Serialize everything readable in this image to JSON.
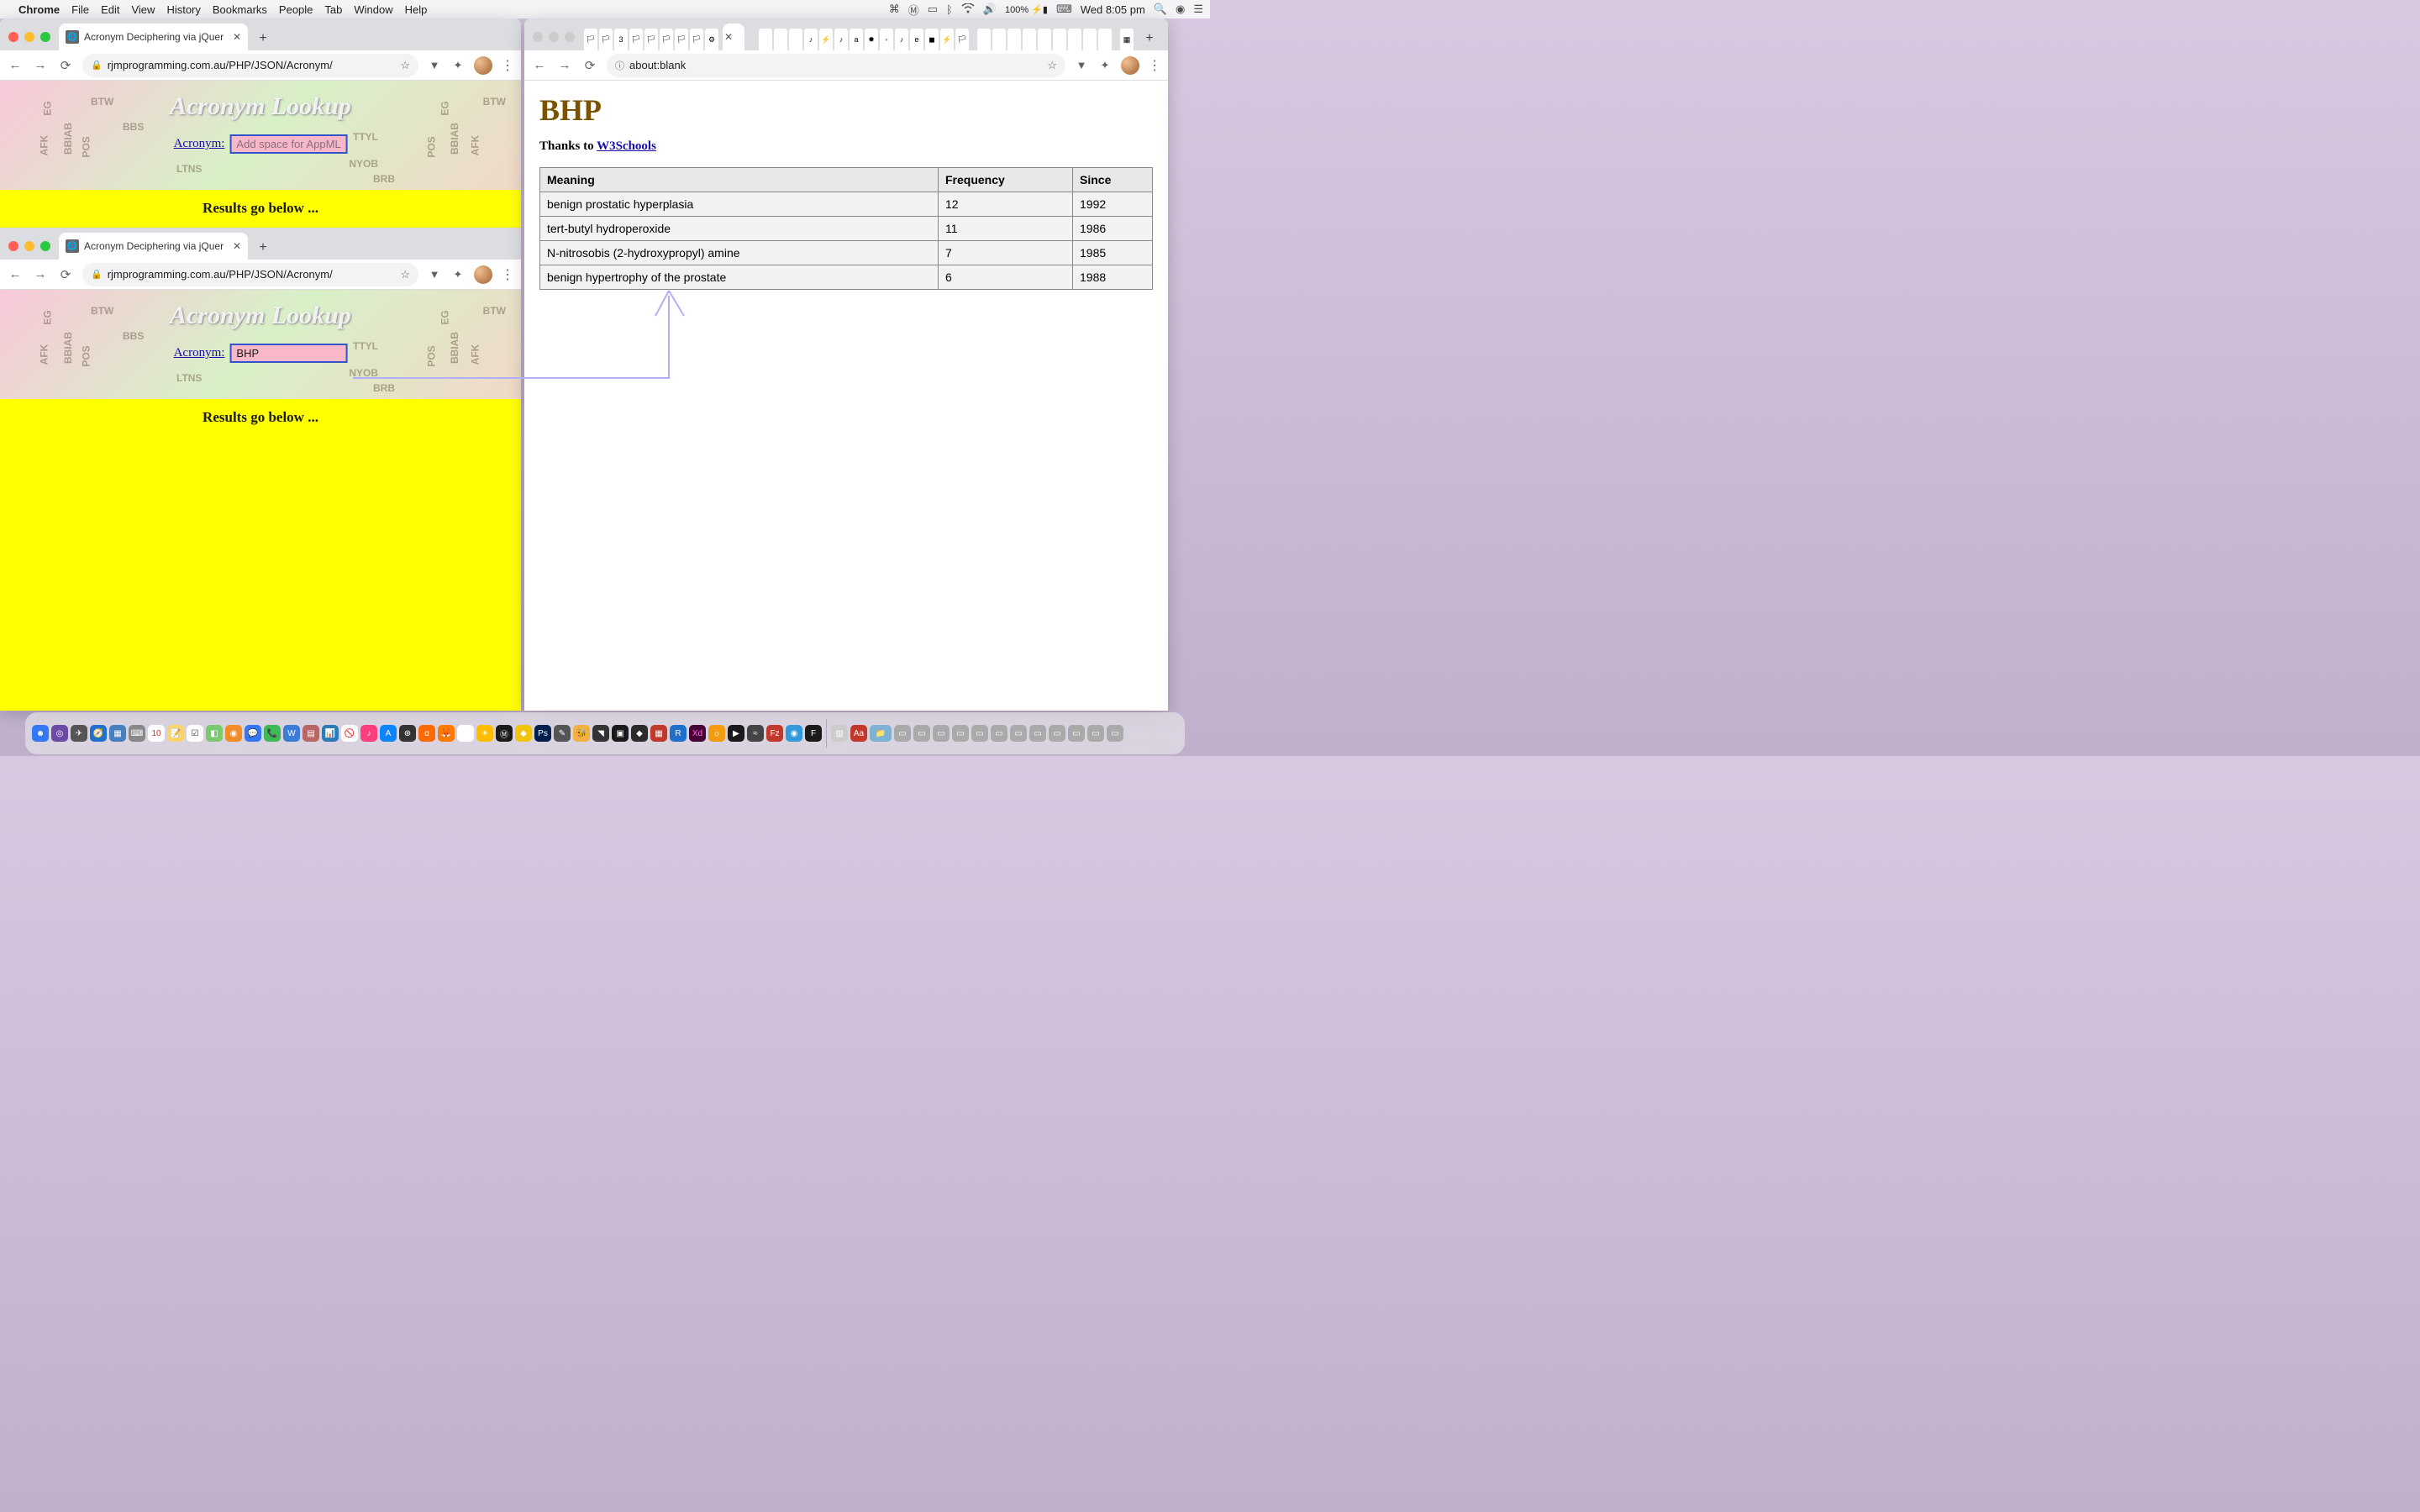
{
  "menubar": {
    "app": "Chrome",
    "items": [
      "File",
      "Edit",
      "View",
      "History",
      "Bookmarks",
      "People",
      "Tab",
      "Window",
      "Help"
    ],
    "battery": "100%",
    "clock": "Wed 8:05 pm"
  },
  "windowLeft": {
    "tab": {
      "title": "Acronym Deciphering via jQuer"
    },
    "url": "rjmprogramming.com.au/PHP/JSON/Acronym/",
    "instance1": {
      "title": "Acronym Lookup",
      "label": "Acronym:",
      "placeholder": "Add space for AppML",
      "value": "",
      "results": "Results go below ...",
      "bg": {
        "btw": "BTW",
        "bbs": "BBS",
        "ltns": "LTNS",
        "ttyl": "TTYL",
        "nyob": "NYOB",
        "brb": "BRB",
        "afk": "AFK",
        "bbiab": "BBIAB",
        "eg": "EG",
        "pos": "POS"
      }
    },
    "instance2": {
      "tab": {
        "title": "Acronym Deciphering via jQuer"
      },
      "url": "rjmprogramming.com.au/PHP/JSON/Acronym/",
      "title": "Acronym Lookup",
      "label": "Acronym:",
      "value": "BHP ",
      "results": "Results go below ...",
      "bg": {
        "btw": "BTW",
        "bbs": "BBS",
        "ltns": "LTNS",
        "ttyl": "TTYL",
        "nyob": "NYOB",
        "brb": "BRB",
        "afk": "AFK",
        "bbiab": "BBIAB",
        "eg": "EG",
        "pos": "POS"
      }
    }
  },
  "windowRight": {
    "url": "about:blank",
    "heading": "BHP",
    "thanks_pre": "Thanks to ",
    "thanks_link": "W3Schools",
    "table": {
      "headers": [
        "Meaning",
        "Frequency",
        "Since"
      ],
      "rows": [
        [
          "benign prostatic hyperplasia",
          "12",
          "1992"
        ],
        [
          "tert-butyl hydroperoxide",
          "11",
          "1986"
        ],
        [
          "N-nitrosobis (2-hydroxypropyl) amine",
          "7",
          "1985"
        ],
        [
          "benign hypertrophy of the prostate",
          "6",
          "1988"
        ]
      ]
    }
  }
}
